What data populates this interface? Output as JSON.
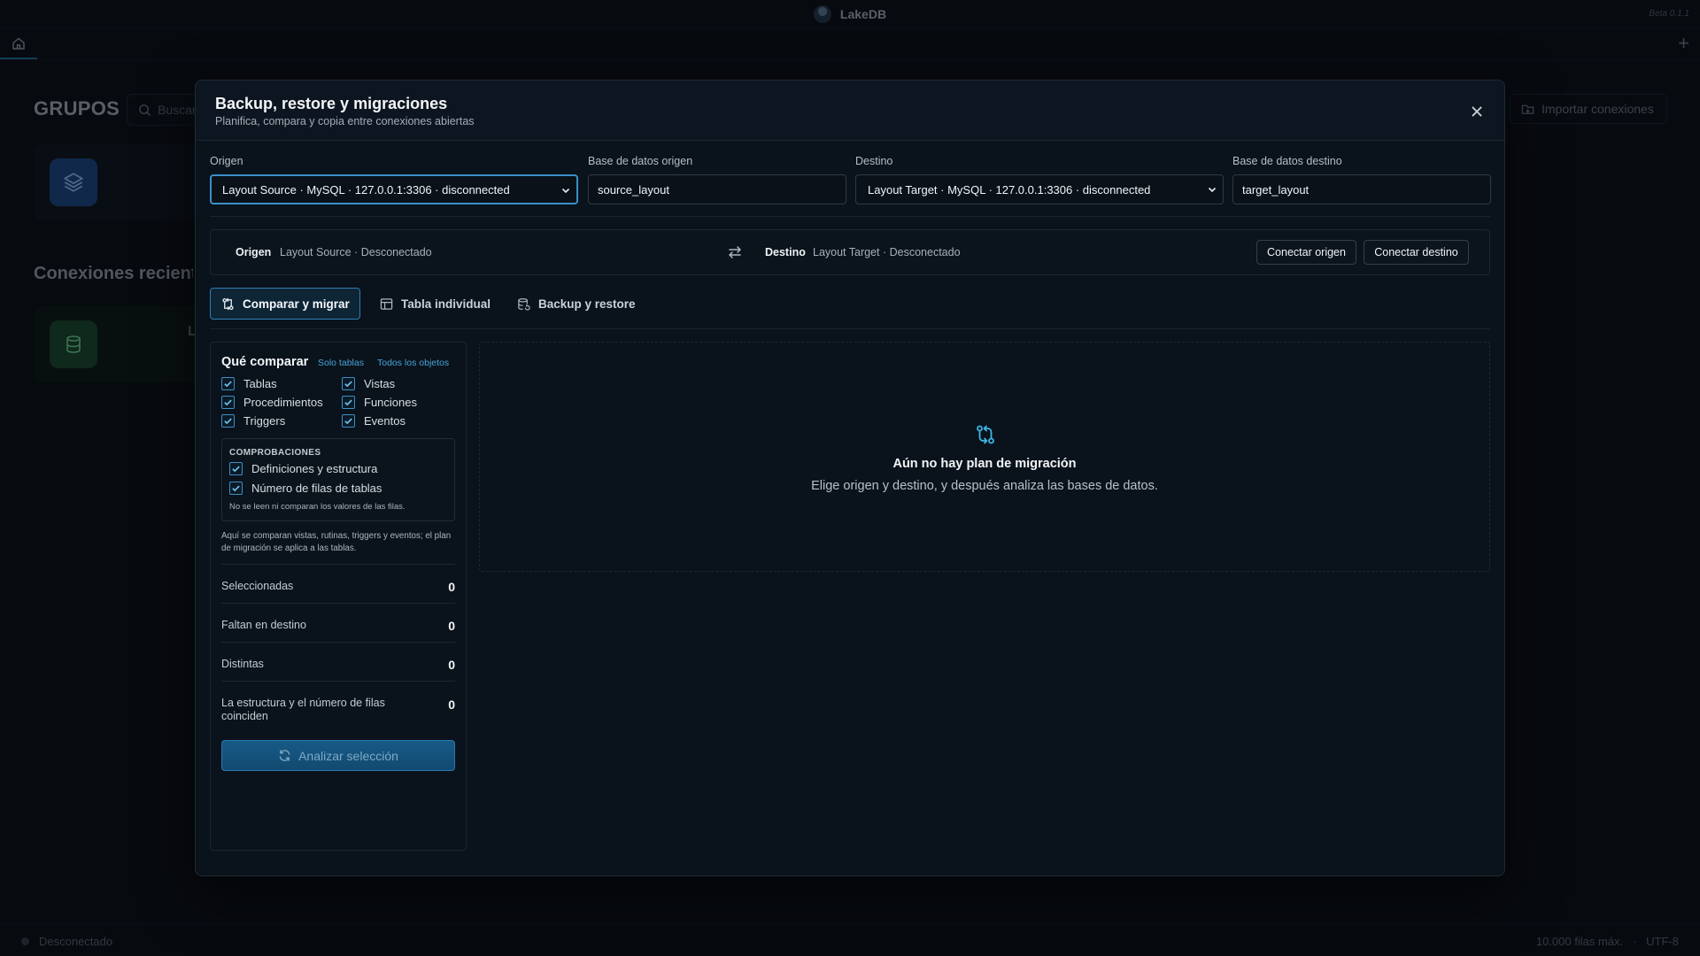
{
  "app": {
    "title": "LakeDB",
    "version": "Beta 0.1.1"
  },
  "background": {
    "groups_title": "GRUPOS",
    "search_placeholder": "Buscar",
    "recent_title": "Conexiones recientes",
    "recent_card_letter": "L",
    "import_button": "Importar conexiones"
  },
  "statusbar": {
    "state": "Desconectado",
    "max_rows": "10.000 filas máx.",
    "separator": "·",
    "encoding": "UTF-8"
  },
  "modal": {
    "title": "Backup, restore y migraciones",
    "subtitle": "Planifica, compara y copia entre conexiones abiertas",
    "source_label": "Origen",
    "source_value": "Layout Source · MySQL · 127.0.0.1:3306 · disconnected",
    "source_db_label": "Base de datos origen",
    "source_db_value": "source_layout",
    "target_label": "Destino",
    "target_value": "Layout Target · MySQL · 127.0.0.1:3306 · disconnected",
    "target_db_label": "Base de datos destino",
    "target_db_value": "target_layout",
    "connection": {
      "source_label": "Origen",
      "source_status": "Layout Source · Desconectado",
      "target_label": "Destino",
      "target_status": "Layout Target · Desconectado",
      "connect_source": "Conectar origen",
      "connect_target": "Conectar destino"
    },
    "tabs": [
      {
        "label": "Comparar y migrar",
        "active": true
      },
      {
        "label": "Tabla individual",
        "active": false
      },
      {
        "label": "Backup y restore",
        "active": false
      }
    ],
    "compare": {
      "title": "Qué comparar",
      "link_tables_only": "Solo tablas",
      "link_all_objects": "Todos los objetos",
      "objects": [
        {
          "label": "Tablas",
          "checked": true
        },
        {
          "label": "Vistas",
          "checked": true
        },
        {
          "label": "Procedimientos",
          "checked": true
        },
        {
          "label": "Funciones",
          "checked": true
        },
        {
          "label": "Triggers",
          "checked": true
        },
        {
          "label": "Eventos",
          "checked": true
        }
      ],
      "checks_title": "COMPROBACIONES",
      "checks": [
        {
          "label": "Definiciones y estructura",
          "checked": true
        },
        {
          "label": "Número de filas de tablas",
          "checked": true
        }
      ],
      "checks_note": "No se leen ni comparan los valores de las filas.",
      "note": "Aquí se comparan vistas, rutinas, triggers y eventos; el plan de migración se aplica a las tablas.",
      "stats": [
        {
          "label": "Seleccionadas",
          "value": "0"
        },
        {
          "label": "Faltan en destino",
          "value": "0"
        },
        {
          "label": "Distintas",
          "value": "0"
        },
        {
          "label": "La estructura y el número de filas coinciden",
          "value": "0"
        }
      ],
      "analyze_button": "Analizar selección"
    },
    "empty": {
      "title": "Aún no hay plan de migración",
      "subtitle": "Elige origen y destino, y después analiza las bases de datos."
    },
    "colors": {
      "accent": "#3a90c9",
      "link": "#47a6de",
      "icon_teal": "#3db7e6"
    }
  }
}
